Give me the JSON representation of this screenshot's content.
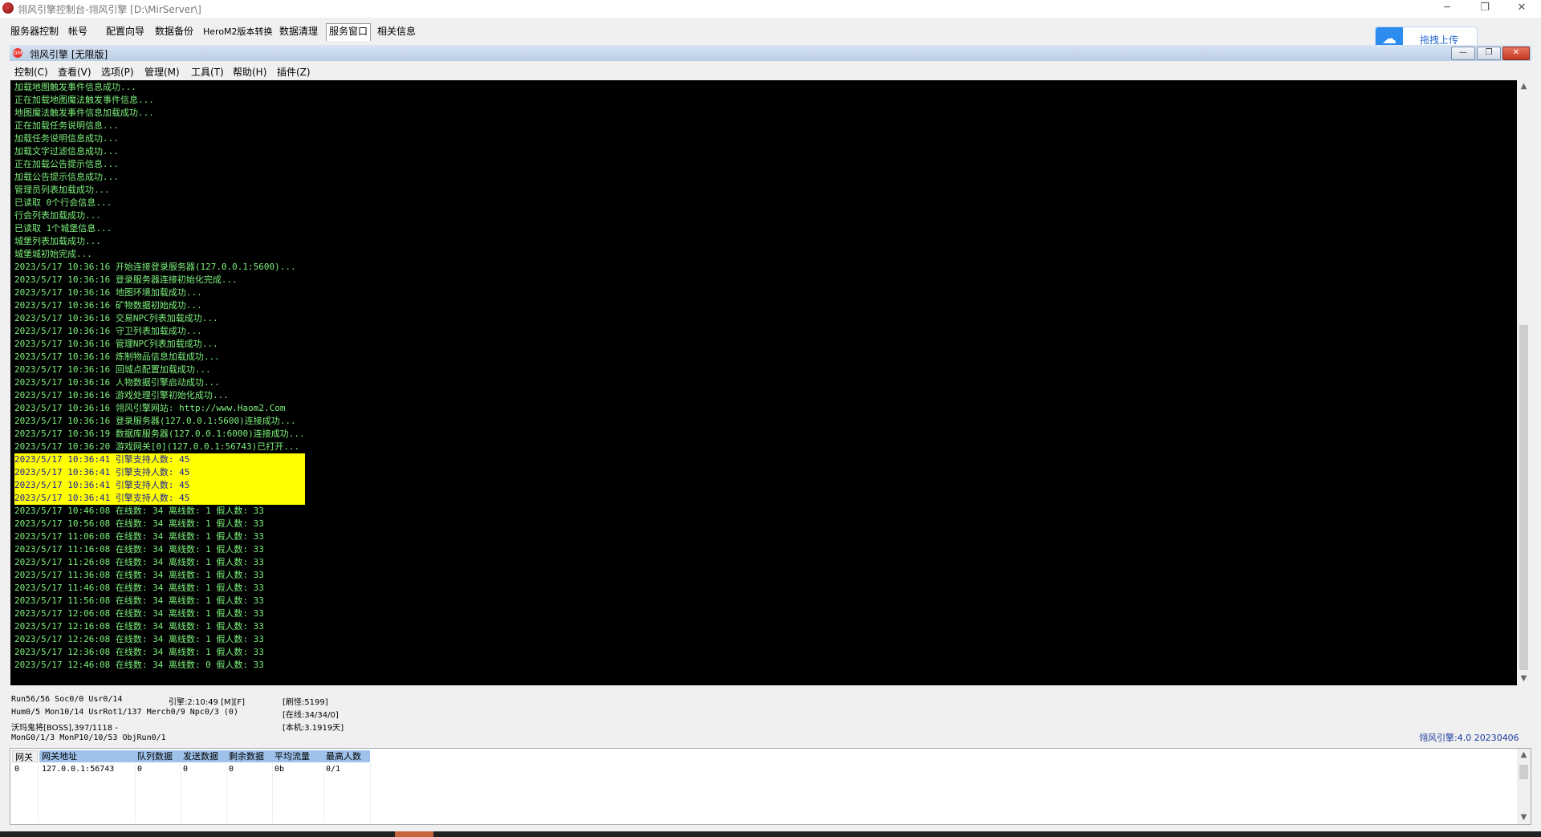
{
  "window": {
    "title": "翎风引擎控制台-翎风引擎 [D:\\MirServer\\]",
    "minimize": "─",
    "maximize": "❐",
    "close": "✕"
  },
  "tabs": [
    "服务器控制",
    "帐号",
    "配置向导",
    "数据备份",
    "HeroM2版本转换",
    "数据清理",
    "服务窗口",
    "相关信息"
  ],
  "upload": {
    "label": "拖拽上传",
    "icon": "cloud-icon"
  },
  "inner": {
    "title": "翎风引擎 [无限版]",
    "icon_text": "GM",
    "minimize": "—",
    "restore": "❐",
    "close": "✕"
  },
  "menu": [
    "控制(C)",
    "查看(V)",
    "选项(P)",
    "管理(M)",
    "工具(T)",
    "帮助(H)",
    "插件(Z)"
  ],
  "log": [
    {
      "text": "加载地图触发事件信息成功...",
      "hl": false
    },
    {
      "text": "正在加载地图魔法触发事件信息...",
      "hl": false
    },
    {
      "text": "地图魔法触发事件信息加载成功...",
      "hl": false
    },
    {
      "text": "正在加载任务说明信息...",
      "hl": false
    },
    {
      "text": "加载任务说明信息成功...",
      "hl": false
    },
    {
      "text": "加载文字过滤信息成功...",
      "hl": false
    },
    {
      "text": "正在加载公告提示信息...",
      "hl": false
    },
    {
      "text": "加载公告提示信息成功...",
      "hl": false
    },
    {
      "text": "管理员列表加载成功...",
      "hl": false
    },
    {
      "text": "已读取 0个行会信息...",
      "hl": false
    },
    {
      "text": "行会列表加载成功...",
      "hl": false
    },
    {
      "text": "已读取 1个城堡信息...",
      "hl": false
    },
    {
      "text": "城堡列表加载成功...",
      "hl": false
    },
    {
      "text": "城堡城初始完成...",
      "hl": false
    },
    {
      "text": "2023/5/17 10:36:16 开始连接登录服务器(127.0.0.1:5600)...",
      "hl": false
    },
    {
      "text": "2023/5/17 10:36:16 登录服务器连接初始化完成...",
      "hl": false
    },
    {
      "text": "2023/5/17 10:36:16 地图环境加载成功...",
      "hl": false
    },
    {
      "text": "2023/5/17 10:36:16 矿物数据初始成功...",
      "hl": false
    },
    {
      "text": "2023/5/17 10:36:16 交易NPC列表加载成功...",
      "hl": false
    },
    {
      "text": "2023/5/17 10:36:16 守卫列表加载成功...",
      "hl": false
    },
    {
      "text": "2023/5/17 10:36:16 管理NPC列表加载成功...",
      "hl": false
    },
    {
      "text": "2023/5/17 10:36:16 炼制物品信息加载成功...",
      "hl": false
    },
    {
      "text": "2023/5/17 10:36:16 回城点配置加载成功...",
      "hl": false
    },
    {
      "text": "2023/5/17 10:36:16 人物数据引擎启动成功...",
      "hl": false
    },
    {
      "text": "2023/5/17 10:36:16 游戏处理引擎初始化成功...",
      "hl": false
    },
    {
      "text": "2023/5/17 10:36:16 翎风引擎网站: http://www.Haom2.Com",
      "hl": false
    },
    {
      "text": "2023/5/17 10:36:16 登录服务器(127.0.0.1:5600)连接成功...",
      "hl": false
    },
    {
      "text": "2023/5/17 10:36:19 数据库服务器(127.0.0.1:6000)连接成功...",
      "hl": false
    },
    {
      "text": "2023/5/17 10:36:20 游戏网关[0](127.0.0.1:56743)已打开...",
      "hl": false
    },
    {
      "text": "2023/5/17 10:36:41 引擎支持人数: 45",
      "hl": true
    },
    {
      "text": "2023/5/17 10:36:41 引擎支持人数: 45",
      "hl": true
    },
    {
      "text": "2023/5/17 10:36:41 引擎支持人数: 45",
      "hl": true
    },
    {
      "text": "2023/5/17 10:36:41 引擎支持人数: 45",
      "hl": true
    },
    {
      "text": "2023/5/17 10:46:08 在线数: 34 离线数: 1 假人数: 33",
      "hl": false
    },
    {
      "text": "2023/5/17 10:56:08 在线数: 34 离线数: 1 假人数: 33",
      "hl": false
    },
    {
      "text": "2023/5/17 11:06:08 在线数: 34 离线数: 1 假人数: 33",
      "hl": false
    },
    {
      "text": "2023/5/17 11:16:08 在线数: 34 离线数: 1 假人数: 33",
      "hl": false
    },
    {
      "text": "2023/5/17 11:26:08 在线数: 34 离线数: 1 假人数: 33",
      "hl": false
    },
    {
      "text": "2023/5/17 11:36:08 在线数: 34 离线数: 1 假人数: 33",
      "hl": false
    },
    {
      "text": "2023/5/17 11:46:08 在线数: 34 离线数: 1 假人数: 33",
      "hl": false
    },
    {
      "text": "2023/5/17 11:56:08 在线数: 34 离线数: 1 假人数: 33",
      "hl": false
    },
    {
      "text": "2023/5/17 12:06:08 在线数: 34 离线数: 1 假人数: 33",
      "hl": false
    },
    {
      "text": "2023/5/17 12:16:08 在线数: 34 离线数: 1 假人数: 33",
      "hl": false
    },
    {
      "text": "2023/5/17 12:26:08 在线数: 34 离线数: 1 假人数: 33",
      "hl": false
    },
    {
      "text": "2023/5/17 12:36:08 在线数: 34 离线数: 1 假人数: 33",
      "hl": false
    },
    {
      "text": "2023/5/17 12:46:08 在线数: 34 离线数: 0 假人数: 33",
      "hl": false
    }
  ],
  "status": {
    "line1": "Run56/56 Soc0/0 Usr0/14",
    "line2": "Hum0/5 Mon10/14 UsrRot1/137 Merch0/9 Npc0/3 (0)",
    "line3": "沃玛鬼将[BOSS],397/1118 -",
    "line4": "MonG0/1/3 MonP10/10/53 ObjRun0/1",
    "engine": "引擎:2:10:49 [M][F]",
    "refresh": "[刷怪:5199]",
    "online": "[在线:34/34/0]",
    "local": "[本机:3.1919天]",
    "version": "翎风引擎:4.0 20230406"
  },
  "gateway": {
    "headers": [
      "网关",
      "网关地址",
      "队列数据",
      "发送数据",
      "剩余数据",
      "平均流量",
      "最高人数"
    ],
    "rows": [
      [
        "0",
        "127.0.0.1:56743",
        "0",
        "0",
        "0",
        "0b",
        "0/1"
      ]
    ]
  },
  "colors": {
    "console_bg": "#000000",
    "console_text": "#7df07d",
    "highlight_bg": "#ffff00",
    "highlight_text": "#2020a0",
    "accent": "#2d8cf0"
  }
}
